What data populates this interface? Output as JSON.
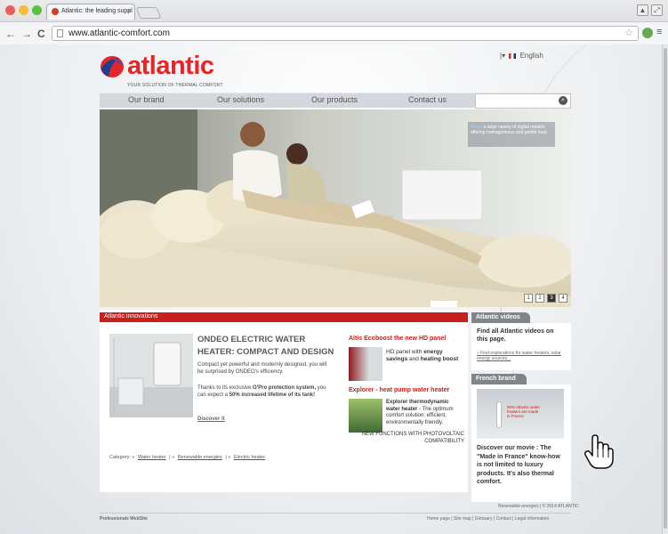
{
  "browser": {
    "tab_title": "Atlantic: the leading suppl",
    "tab_close": "×",
    "back": "←",
    "forward": "→",
    "reload": "C",
    "url": "www.atlantic-comfort.com",
    "star": "☆",
    "menu": "≡"
  },
  "header": {
    "logo_text": "atlantic",
    "tagline": "YOUR SOLUTION OF THERMAL COMFORT",
    "language": "English",
    "lang_separator": "|▾"
  },
  "nav": {
    "items": [
      "Our brand",
      "Our solutions",
      "Our products",
      "Contact us"
    ]
  },
  "hero": {
    "callout_highlight": "Heats",
    "callout": "a large variety of digital models offering homogeneous and gentle heat",
    "pages": [
      "1",
      "2",
      "3",
      "4"
    ],
    "active_page": "3"
  },
  "innovations": {
    "bar_title": "Atlantic innovations",
    "feature_title": "ONDEO ELECTRIC WATER HEATER: COMPACT AND DESIGN",
    "feature_p1": "Compact yet powerful and modernly designed, you will be surprised by ONDEO's efficiency.",
    "feature_p2a": "Thanks to its exclusive ",
    "feature_p2b": "O'Pro protection system,",
    "feature_p2c": " you can expect a ",
    "feature_p2d": "50% increased lifetime of its tank!",
    "discover": "Discover it",
    "aside1_title": "Altis Ecoboost the new HD panel",
    "aside1_text_a": "HD panel with ",
    "aside1_text_b": "energy savings",
    "aside1_text_c": " and ",
    "aside1_text_d": "heating boost",
    "aside2_title": "Explorer - heat pump water heater",
    "aside2_text_a": "Explorer thermodynamic water heater",
    "aside2_text_b": " - The optimum comfort solution: efficient, environmentally friendly.",
    "aside2_text_c": "NEW FUNCTIONS WITH PHOTOVOLTAIC COMPATIBILITY",
    "category_label": "Category:",
    "categories": [
      "Water heater",
      "Renewable energies",
      "Electric heater"
    ]
  },
  "videos": {
    "tab": "Atlantic videos",
    "text": "Find all Atlantic videos on this page.",
    "link": "Find explorations for water heaters, solar energy sources..."
  },
  "french": {
    "tab": "French brand",
    "img_text": "90% Atlantic water heaters are made in France",
    "text": "Discover our movie : The \"Made in France\" know-how is not limited to luxury products. It's also thermal comfort."
  },
  "footer": {
    "box_links": [
      "Renewable energies",
      "© 2014 ATLANTIC"
    ],
    "left": "Professionals WebSite",
    "links": [
      "Home page",
      "Site map",
      "Glossary",
      "Contact",
      "Legal information"
    ]
  }
}
